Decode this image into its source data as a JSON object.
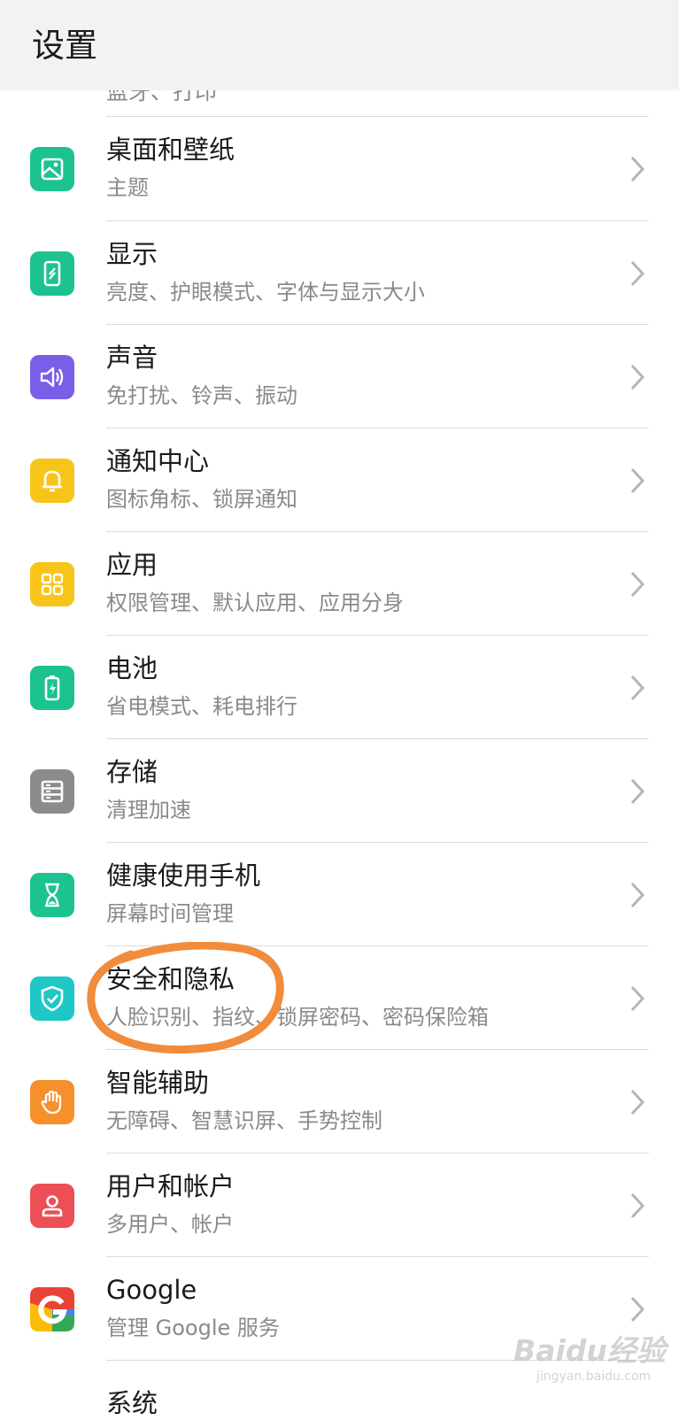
{
  "header": {
    "title": "设置"
  },
  "partial_top": "蓝牙、打印",
  "items": [
    {
      "title": "桌面和壁纸",
      "subtitle": "主题",
      "icon": "image-icon",
      "color": "#1cc28f"
    },
    {
      "title": "显示",
      "subtitle": "亮度、护眼模式、字体与显示大小",
      "icon": "display-icon",
      "color": "#1cc28f"
    },
    {
      "title": "声音",
      "subtitle": "免打扰、铃声、振动",
      "icon": "speaker-icon",
      "color": "#7a5ee8"
    },
    {
      "title": "通知中心",
      "subtitle": "图标角标、锁屏通知",
      "icon": "bell-icon",
      "color": "#f7c51a"
    },
    {
      "title": "应用",
      "subtitle": "权限管理、默认应用、应用分身",
      "icon": "apps-grid-icon",
      "color": "#f7c51a"
    },
    {
      "title": "电池",
      "subtitle": "省电模式、耗电排行",
      "icon": "battery-icon",
      "color": "#1cc28f"
    },
    {
      "title": "存储",
      "subtitle": "清理加速",
      "icon": "storage-icon",
      "color": "#8c8c8c"
    },
    {
      "title": "健康使用手机",
      "subtitle": "屏幕时间管理",
      "icon": "hourglass-icon",
      "color": "#1cc28f"
    },
    {
      "title": "安全和隐私",
      "subtitle": "人脸识别、指纹、锁屏密码、密码保险箱",
      "icon": "shield-icon",
      "color": "#1fc7c7"
    },
    {
      "title": "智能辅助",
      "subtitle": "无障碍、智慧识屏、手势控制",
      "icon": "hand-icon",
      "color": "#f7902a"
    },
    {
      "title": "用户和帐户",
      "subtitle": "多用户、帐户",
      "icon": "user-icon",
      "color": "#ec4f55"
    },
    {
      "title": "Google",
      "subtitle": "管理 Google 服务",
      "icon": "google-icon",
      "color": "#ffffff"
    }
  ],
  "partial_bottom": "系统",
  "watermark": {
    "text": "Baidu经验",
    "sub": "jingyan.baidu.com"
  },
  "colors": {
    "annotation": "#f08c3c"
  }
}
